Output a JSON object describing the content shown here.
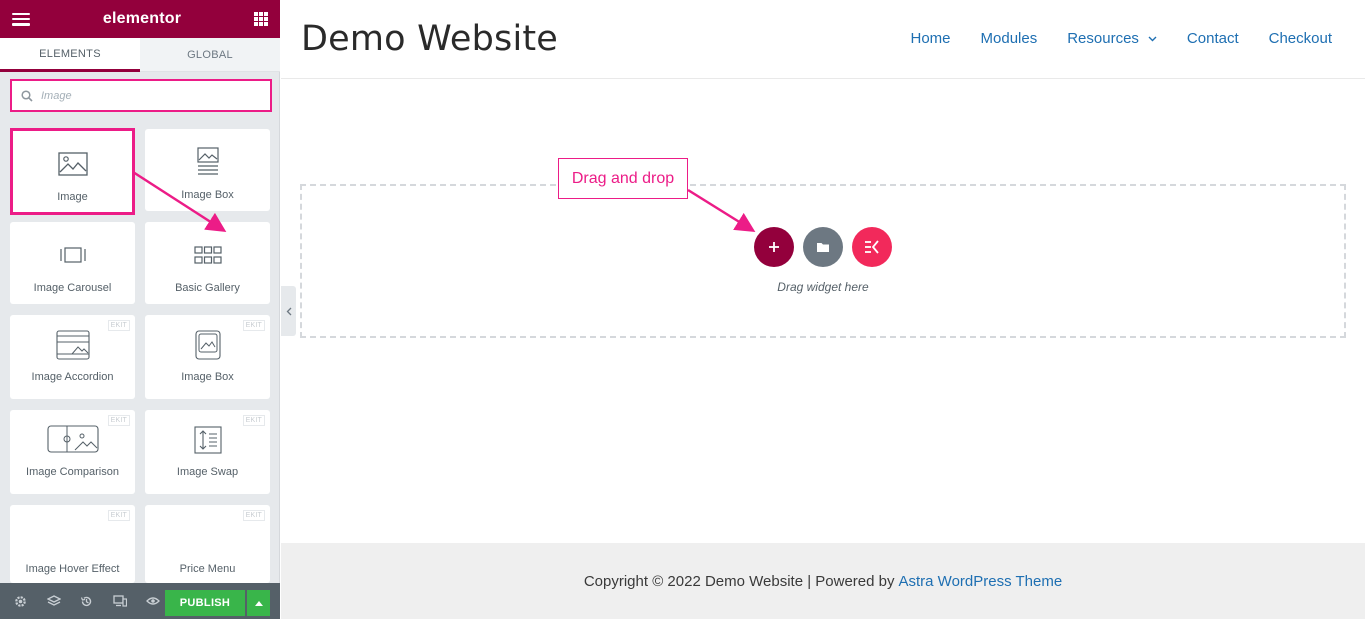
{
  "sidebar": {
    "brand": "elementor",
    "tabs": [
      "ELEMENTS",
      "GLOBAL"
    ],
    "search": {
      "value": "",
      "placeholder": "Image"
    },
    "widgets": [
      {
        "label": "Image",
        "icon": "image-icon",
        "badge": ""
      },
      {
        "label": "Image Box",
        "icon": "image-box-icon",
        "badge": ""
      },
      {
        "label": "Image Carousel",
        "icon": "image-carousel-icon",
        "badge": ""
      },
      {
        "label": "Basic Gallery",
        "icon": "gallery-grid-icon",
        "badge": ""
      },
      {
        "label": "Image Accordion",
        "icon": "image-accordion-icon",
        "badge": "EKIT"
      },
      {
        "label": "Image Box",
        "icon": "ekit-image-box-icon",
        "badge": "EKIT"
      },
      {
        "label": "Image Comparison",
        "icon": "image-comparison-icon",
        "badge": "EKIT"
      },
      {
        "label": "Image Swap",
        "icon": "image-swap-icon",
        "badge": "EKIT"
      },
      {
        "label": "Image Hover Effect",
        "icon": "image-hover-effect-icon",
        "badge": "EKIT"
      },
      {
        "label": "Price Menu",
        "icon": "price-menu-icon",
        "badge": "EKIT"
      }
    ],
    "footer": {
      "publish_label": "PUBLISH"
    }
  },
  "site": {
    "title": "Demo Website",
    "nav": [
      "Home",
      "Modules",
      "Resources",
      "Contact",
      "Checkout"
    ]
  },
  "canvas": {
    "drag_text": "Drag widget here",
    "callout": "Drag and drop"
  },
  "footer": {
    "copyright": "Copyright © 2022 Demo Website | Powered by",
    "link": "Astra WordPress Theme"
  },
  "colors": {
    "brand": "#93003c",
    "annotation": "#ec1c87",
    "publish": "#39b54a",
    "link": "#1e6fb2"
  }
}
